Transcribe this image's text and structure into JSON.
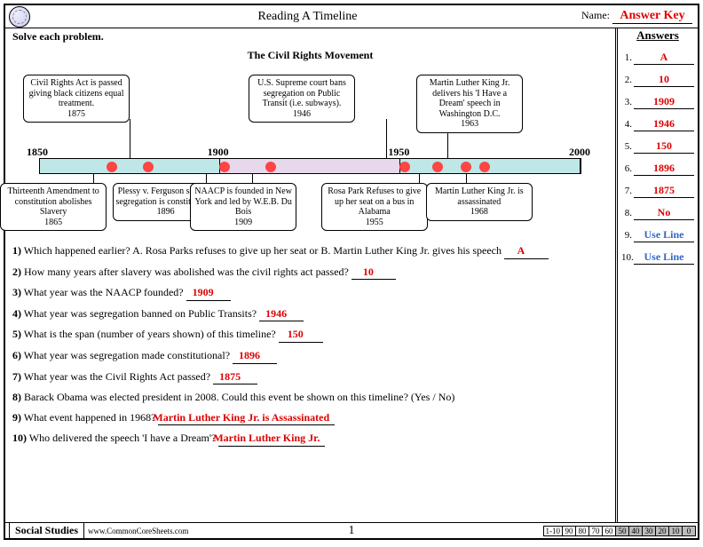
{
  "header": {
    "title": "Reading A Timeline",
    "nameLabel": "Name:",
    "answerKey": "Answer Key"
  },
  "instructions": "Solve each problem.",
  "subtitle": "The Civil Rights Movement",
  "sidebar": {
    "title": "Answers",
    "items": [
      {
        "n": "1.",
        "v": "A"
      },
      {
        "n": "2.",
        "v": "10"
      },
      {
        "n": "3.",
        "v": "1909"
      },
      {
        "n": "4.",
        "v": "1946"
      },
      {
        "n": "5.",
        "v": "150"
      },
      {
        "n": "6.",
        "v": "1896"
      },
      {
        "n": "7.",
        "v": "1875"
      },
      {
        "n": "8.",
        "v": "No"
      },
      {
        "n": "9.",
        "v": "Use Line",
        "blue": true
      },
      {
        "n": "10.",
        "v": "Use Line",
        "blue": true
      }
    ]
  },
  "timeline": {
    "ticks": [
      "1850",
      "1900",
      "1950",
      "2000"
    ],
    "segColors": [
      "#bfe7e7",
      "#e8d8ec",
      "#bfe7e7"
    ],
    "events": [
      {
        "pct": 10,
        "pos": "bottom",
        "text": "Thirteenth Amendment to constitution abolishes Slavery",
        "year": "1865"
      },
      {
        "pct": 16.7,
        "pos": "top",
        "text": "Civil Rights Act is passed giving black citizens equal treatment.",
        "year": "1875"
      },
      {
        "pct": 30.7,
        "pos": "bottom",
        "text": "Plessy v. Ferguson say that segregation is constitutional",
        "year": "1896"
      },
      {
        "pct": 39.3,
        "pos": "bottom",
        "text": "NAACP is founded in New York and led by W.E.B. Du Bois",
        "year": "1909"
      },
      {
        "pct": 64,
        "pos": "top",
        "text": "U.S. Supreme court bans segregation on Public Transit (i.e. subways).",
        "year": "1946"
      },
      {
        "pct": 70,
        "pos": "bottom",
        "text": "Rosa Park Refuses to give up her seat on a bus in Alabama",
        "year": "1955"
      },
      {
        "pct": 75.3,
        "pos": "top",
        "text": "Martin Luther King Jr. delivers his 'I Have a Dream' speech in Washington D.C.",
        "year": "1963"
      },
      {
        "pct": 78.7,
        "pos": "bottom",
        "text": "Martin Luther King Jr. is assassinated",
        "year": "1968"
      }
    ]
  },
  "questions": [
    {
      "n": "1)",
      "text": "Which happened earlier?   A. Rosa Parks refuses to give up her seat   or   B. Martin Luther King Jr. gives his speech",
      "ans": "A"
    },
    {
      "n": "2)",
      "text": "How many years after slavery was abolished was the civil rights act passed?",
      "ans": "10"
    },
    {
      "n": "3)",
      "text": "What year was the NAACP founded?",
      "ans": "1909"
    },
    {
      "n": "4)",
      "text": "What year was segregation banned on Public Transits?",
      "ans": "1946"
    },
    {
      "n": "5)",
      "text": "What is the span (number of years shown) of this timeline?",
      "ans": "150"
    },
    {
      "n": "6)",
      "text": "What year was segregation made constitutional?",
      "ans": "1896"
    },
    {
      "n": "7)",
      "text": "What year was the Civil Rights Act passed?",
      "ans": "1875"
    },
    {
      "n": "8)",
      "text": "Barack Obama was elected president in 2008. Could this event be shown on this timeline? (Yes / No)",
      "ans": ""
    },
    {
      "n": "9)",
      "text": "What event happened in 1968?",
      "ans": "Martin Luther King Jr. is Assassinated"
    },
    {
      "n": "10)",
      "text": "Who delivered the speech 'I have a Dream'?",
      "ans": "Martin Luther King Jr."
    }
  ],
  "footer": {
    "subject": "Social Studies",
    "url": "www.CommonCoreSheets.com",
    "page": "1",
    "gradeLabel": "1-10",
    "grades": [
      "90",
      "80",
      "70",
      "60",
      "50",
      "40",
      "30",
      "20",
      "10",
      "0"
    ]
  }
}
